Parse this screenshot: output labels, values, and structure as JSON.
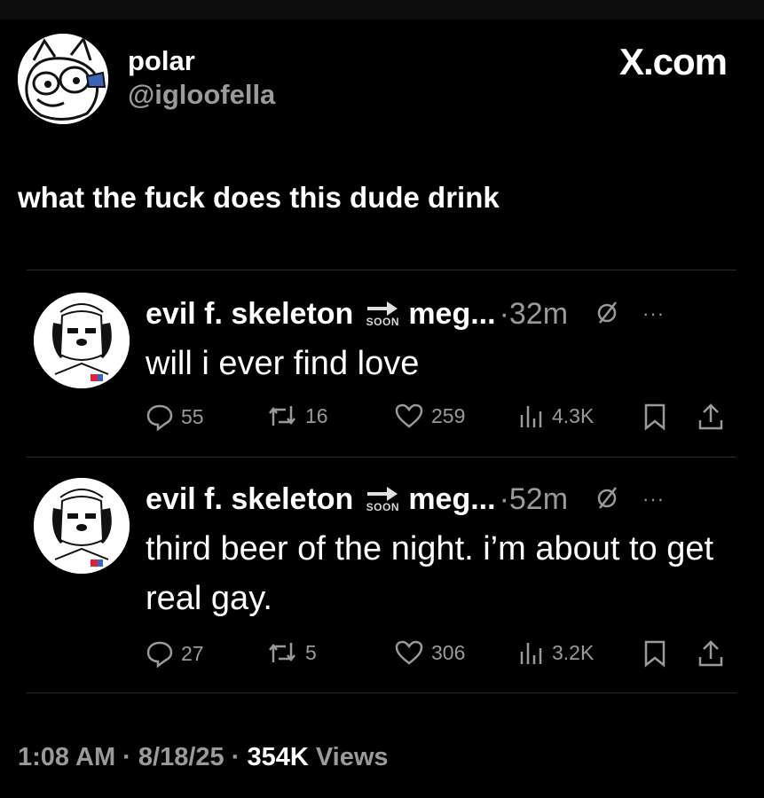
{
  "header": {
    "display_name": "polar",
    "handle": "@igloofella",
    "brand": "X.com"
  },
  "tweet": {
    "text": "what the fuck does this dude drink"
  },
  "quotes": [
    {
      "name": "evil f. skeleton",
      "soon_label": "SOON",
      "name2": "meg...",
      "time": "·32m",
      "more": "···",
      "text": "will i ever find love",
      "replies": "55",
      "reposts": "16",
      "likes": "259",
      "views": "4.3K"
    },
    {
      "name": "evil f. skeleton",
      "soon_label": "SOON",
      "name2": "meg...",
      "time": "·52m",
      "more": "···",
      "text": "third beer of the night. i’m about to get real gay.",
      "replies": "27",
      "reposts": "5",
      "likes": "306",
      "views": "3.2K"
    }
  ],
  "footer": {
    "time": "1:08 AM",
    "sep1": " · ",
    "date": "8/18/25",
    "sep2": " · ",
    "views_count": "354K",
    "views_label": " Views"
  },
  "colors": {
    "background": "#000000",
    "text": "#ffffff",
    "muted": "#9a9a9a"
  },
  "icons": [
    "reply-icon",
    "repost-icon",
    "like-icon",
    "views-icon",
    "bookmark-icon",
    "share-icon",
    "mute-icon",
    "more-icon",
    "arrow-right-icon"
  ]
}
